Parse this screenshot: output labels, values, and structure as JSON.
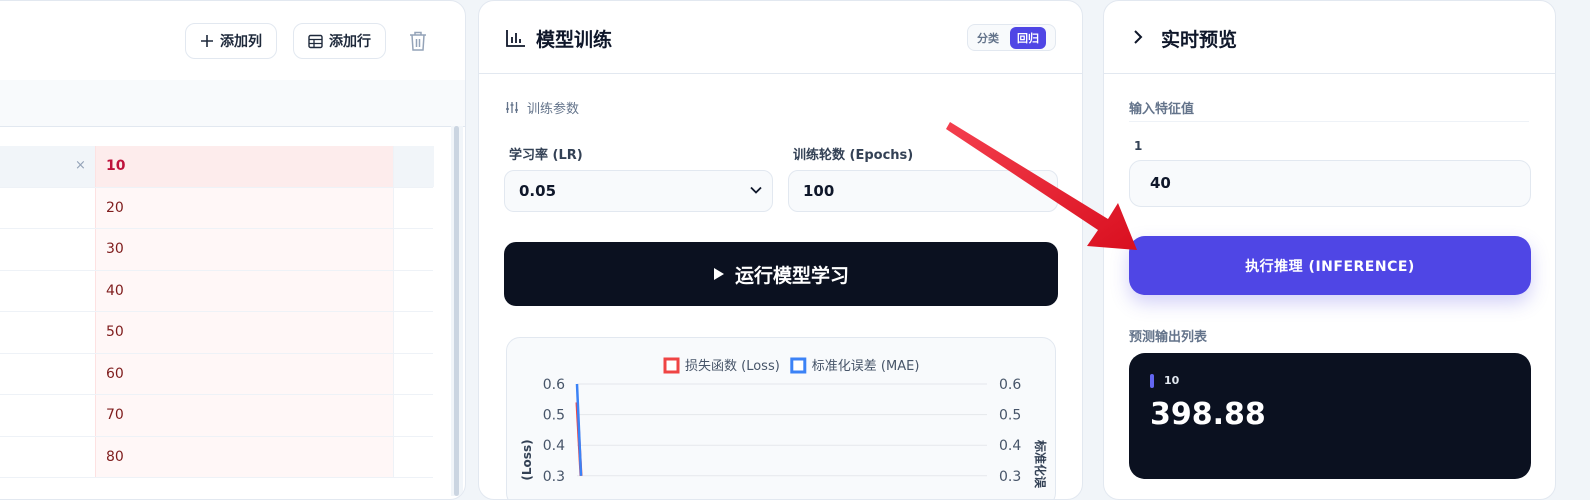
{
  "data_panel": {
    "add_col_label": "添加列",
    "add_row_label": "添加行",
    "header_cell": "10",
    "rows": [
      "20",
      "30",
      "40",
      "50",
      "60",
      "70",
      "80"
    ],
    "delete_glyph": "×"
  },
  "training": {
    "title": "模型训练",
    "mode_classification": "分类",
    "mode_regression": "回归",
    "params_label": "训练参数",
    "lr_label": "学习率 (LR)",
    "lr_value": "0.05",
    "epochs_label": "训练轮数 (Epochs)",
    "epochs_value": "100",
    "run_label": "运行模型学习"
  },
  "chart_data": {
    "type": "line",
    "legend": [
      "损失函数 (Loss)",
      "标准化误差 (MAE)"
    ],
    "legend_placement": "top-center",
    "left_axis_label": "(Loss)",
    "right_axis_label": "标准化误",
    "y_ticks": [
      "0.6",
      "0.5",
      "0.4",
      "0.3"
    ],
    "ylim": [
      0.3,
      0.6
    ],
    "grid": true,
    "series": [
      {
        "name": "损失函数 (Loss)",
        "color": "#ef4444",
        "values": [
          0.54,
          0.3
        ]
      },
      {
        "name": "标准化误差 (MAE)",
        "color": "#3b82f6",
        "values": [
          0.6,
          0.3
        ]
      }
    ]
  },
  "preview": {
    "title": "实时预览",
    "input_section_label": "输入特征值",
    "feature_name": "1",
    "feature_value": "40",
    "infer_label": "执行推理 (INFERENCE)",
    "output_section_label": "预测输出列表",
    "output_key": "10",
    "output_value": "398.88"
  },
  "colors": {
    "accent": "#4f46e5",
    "dark": "#0b1120",
    "annotation_arrow": "#e11d2e"
  }
}
